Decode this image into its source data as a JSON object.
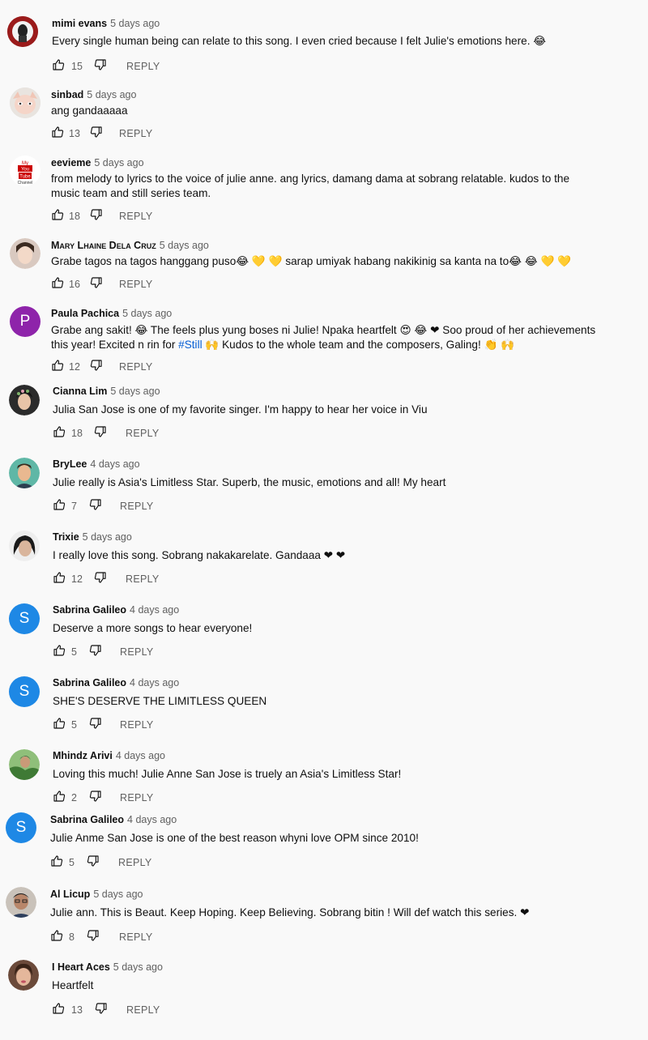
{
  "reply_label": "REPLY",
  "colors": {
    "avatar_purple": "#8e24aa",
    "avatar_blue": "#1e88e5",
    "hashtag": "#065fd4"
  },
  "comments": [
    {
      "author": "mimi evans",
      "time": "5 days ago",
      "text": "Every single human being can relate to this song. I even cried because I felt Julie's emotions here. 😂",
      "likes": "15",
      "avatar": "photo"
    },
    {
      "author": "sinbad",
      "time": "5 days ago",
      "text": "ang gandaaaaa",
      "likes": "13",
      "avatar": "photo"
    },
    {
      "author": "eevieme",
      "time": "5 days ago",
      "text": "from melody to lyrics to the voice of julie anne.  ang lyrics, damang dama at sobrang relatable. kudos to the music team and still series team.",
      "likes": "18",
      "avatar": "logo",
      "avatar_text": [
        "My",
        "You",
        "Tube",
        "Channel"
      ]
    },
    {
      "author": "Mary Lhaine Dela Cruz",
      "time": "5 days ago",
      "text": "Grabe tagos na tagos hanggang puso😂 💛 💛 sarap umiyak habang nakikinig sa kanta na to😂 😂 💛 💛",
      "likes": "16",
      "avatar": "photo"
    },
    {
      "author": "Paula Pachica",
      "time": "5 days ago",
      "text_before": "Grabe ang sakit! 😂  The feels plus yung boses ni Julie! Npaka heartfelt 😍 😂 ❤  Soo proud of her achievements this year! Excited n rin for ",
      "hashtag": "#Still",
      "text_after": " 🙌  Kudos to the whole team and the composers, Galing! 👏 🙌",
      "likes": "12",
      "avatar": "letter",
      "avatar_letter": "P"
    },
    {
      "author": "Cianna Lim",
      "time": "5 days ago",
      "text": "Julia San Jose is one of my favorite singer. I'm happy to hear her voice in Viu",
      "likes": "18",
      "avatar": "photo"
    },
    {
      "author": "BryLee",
      "time": "4 days ago",
      "text": "Julie really is Asia's Limitless Star. Superb, the music, emotions and all! My heart",
      "likes": "7",
      "avatar": "photo"
    },
    {
      "author": "Trixie",
      "time": "5 days ago",
      "text": "I really love this song. Sobrang nakakarelate. Gandaaa ❤ ❤",
      "likes": "12",
      "avatar": "photo"
    },
    {
      "author": "Sabrina Galileo",
      "time": "4 days ago",
      "text": "Deserve a more songs to hear everyone!",
      "likes": "5",
      "avatar": "letter",
      "avatar_letter": "S"
    },
    {
      "author": "Sabrina Galileo",
      "time": "4 days ago",
      "text": "SHE'S DESERVE THE LIMITLESS QUEEN",
      "likes": "5",
      "avatar": "letter",
      "avatar_letter": "S"
    },
    {
      "author": "Mhindz Arivi",
      "time": "4 days ago",
      "text": "Loving this much! Julie Anne San Jose is truely an Asia's Limitless Star!",
      "likes": "2",
      "avatar": "photo"
    },
    {
      "author": "Sabrina Galileo",
      "time": "4 days ago",
      "text": "Julie Anme San Jose is one of the best reason whyni love OPM since 2010!",
      "likes": "5",
      "avatar": "letter",
      "avatar_letter": "S"
    },
    {
      "author": "Al Licup",
      "time": "5 days ago",
      "text": "Julie ann. This is Beaut. Keep Hoping. Keep Believing. Sobrang bitin ! Will def watch this series. ❤",
      "likes": "8",
      "avatar": "photo"
    },
    {
      "author": "I Heart Aces",
      "time": "5 days ago",
      "text": "Heartfelt",
      "likes": "13",
      "avatar": "photo"
    }
  ]
}
